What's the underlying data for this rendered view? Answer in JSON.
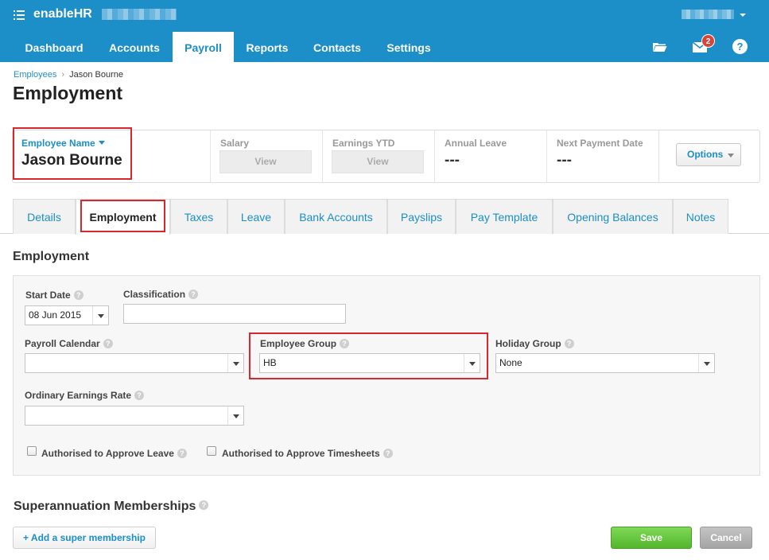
{
  "app": {
    "brand": "enableHR"
  },
  "nav": {
    "items": [
      {
        "label": "Dashboard"
      },
      {
        "label": "Accounts"
      },
      {
        "label": "Payroll"
      },
      {
        "label": "Reports"
      },
      {
        "label": "Contacts"
      },
      {
        "label": "Settings"
      }
    ],
    "active": "Payroll",
    "mail_count": "2",
    "help_label": "?"
  },
  "breadcrumb": {
    "parent": "Employees",
    "sep": "›",
    "current": "Jason Bourne"
  },
  "page": {
    "title": "Employment"
  },
  "summary": {
    "employee_name_label": "Employee Name",
    "employee_name": "Jason Bourne",
    "salary_label": "Salary",
    "salary_button": "View",
    "earnings_label": "Earnings YTD",
    "earnings_button": "View",
    "annual_leave_label": "Annual Leave",
    "annual_leave_value": "---",
    "next_payment_label": "Next Payment Date",
    "next_payment_value": "---",
    "options_label": "Options"
  },
  "tabs": [
    {
      "label": "Details"
    },
    {
      "label": "Employment"
    },
    {
      "label": "Taxes"
    },
    {
      "label": "Leave"
    },
    {
      "label": "Bank Accounts"
    },
    {
      "label": "Payslips"
    },
    {
      "label": "Pay Template"
    },
    {
      "label": "Opening Balances"
    },
    {
      "label": "Notes"
    }
  ],
  "form": {
    "section_title": "Employment",
    "start_date_label": "Start Date",
    "start_date_value": "08 Jun 2015",
    "classification_label": "Classification",
    "classification_value": "",
    "payroll_calendar_label": "Payroll Calendar",
    "payroll_calendar_value": "",
    "employee_group_label": "Employee Group",
    "employee_group_value": "HB",
    "holiday_group_label": "Holiday Group",
    "holiday_group_value": "None",
    "ordinary_rate_label": "Ordinary Earnings Rate",
    "ordinary_rate_value": "",
    "approve_leave_label": "Authorised to Approve Leave",
    "approve_timesheets_label": "Authorised to Approve Timesheets",
    "help_glyph": "?"
  },
  "super": {
    "title": "Superannuation Memberships",
    "add_button": "+ Add a super membership"
  },
  "actions": {
    "save": "Save",
    "cancel": "Cancel"
  }
}
